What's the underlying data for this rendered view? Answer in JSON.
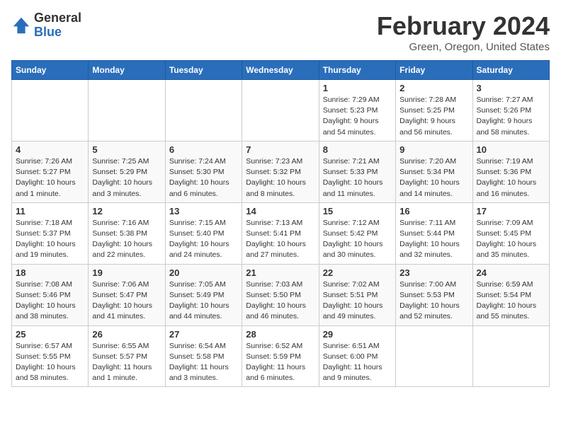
{
  "logo": {
    "general": "General",
    "blue": "Blue"
  },
  "title": "February 2024",
  "location": "Green, Oregon, United States",
  "days_header": [
    "Sunday",
    "Monday",
    "Tuesday",
    "Wednesday",
    "Thursday",
    "Friday",
    "Saturday"
  ],
  "weeks": [
    [
      {
        "day": "",
        "info": ""
      },
      {
        "day": "",
        "info": ""
      },
      {
        "day": "",
        "info": ""
      },
      {
        "day": "",
        "info": ""
      },
      {
        "day": "1",
        "info": "Sunrise: 7:29 AM\nSunset: 5:23 PM\nDaylight: 9 hours\nand 54 minutes."
      },
      {
        "day": "2",
        "info": "Sunrise: 7:28 AM\nSunset: 5:25 PM\nDaylight: 9 hours\nand 56 minutes."
      },
      {
        "day": "3",
        "info": "Sunrise: 7:27 AM\nSunset: 5:26 PM\nDaylight: 9 hours\nand 58 minutes."
      }
    ],
    [
      {
        "day": "4",
        "info": "Sunrise: 7:26 AM\nSunset: 5:27 PM\nDaylight: 10 hours\nand 1 minute."
      },
      {
        "day": "5",
        "info": "Sunrise: 7:25 AM\nSunset: 5:29 PM\nDaylight: 10 hours\nand 3 minutes."
      },
      {
        "day": "6",
        "info": "Sunrise: 7:24 AM\nSunset: 5:30 PM\nDaylight: 10 hours\nand 6 minutes."
      },
      {
        "day": "7",
        "info": "Sunrise: 7:23 AM\nSunset: 5:32 PM\nDaylight: 10 hours\nand 8 minutes."
      },
      {
        "day": "8",
        "info": "Sunrise: 7:21 AM\nSunset: 5:33 PM\nDaylight: 10 hours\nand 11 minutes."
      },
      {
        "day": "9",
        "info": "Sunrise: 7:20 AM\nSunset: 5:34 PM\nDaylight: 10 hours\nand 14 minutes."
      },
      {
        "day": "10",
        "info": "Sunrise: 7:19 AM\nSunset: 5:36 PM\nDaylight: 10 hours\nand 16 minutes."
      }
    ],
    [
      {
        "day": "11",
        "info": "Sunrise: 7:18 AM\nSunset: 5:37 PM\nDaylight: 10 hours\nand 19 minutes."
      },
      {
        "day": "12",
        "info": "Sunrise: 7:16 AM\nSunset: 5:38 PM\nDaylight: 10 hours\nand 22 minutes."
      },
      {
        "day": "13",
        "info": "Sunrise: 7:15 AM\nSunset: 5:40 PM\nDaylight: 10 hours\nand 24 minutes."
      },
      {
        "day": "14",
        "info": "Sunrise: 7:13 AM\nSunset: 5:41 PM\nDaylight: 10 hours\nand 27 minutes."
      },
      {
        "day": "15",
        "info": "Sunrise: 7:12 AM\nSunset: 5:42 PM\nDaylight: 10 hours\nand 30 minutes."
      },
      {
        "day": "16",
        "info": "Sunrise: 7:11 AM\nSunset: 5:44 PM\nDaylight: 10 hours\nand 32 minutes."
      },
      {
        "day": "17",
        "info": "Sunrise: 7:09 AM\nSunset: 5:45 PM\nDaylight: 10 hours\nand 35 minutes."
      }
    ],
    [
      {
        "day": "18",
        "info": "Sunrise: 7:08 AM\nSunset: 5:46 PM\nDaylight: 10 hours\nand 38 minutes."
      },
      {
        "day": "19",
        "info": "Sunrise: 7:06 AM\nSunset: 5:47 PM\nDaylight: 10 hours\nand 41 minutes."
      },
      {
        "day": "20",
        "info": "Sunrise: 7:05 AM\nSunset: 5:49 PM\nDaylight: 10 hours\nand 44 minutes."
      },
      {
        "day": "21",
        "info": "Sunrise: 7:03 AM\nSunset: 5:50 PM\nDaylight: 10 hours\nand 46 minutes."
      },
      {
        "day": "22",
        "info": "Sunrise: 7:02 AM\nSunset: 5:51 PM\nDaylight: 10 hours\nand 49 minutes."
      },
      {
        "day": "23",
        "info": "Sunrise: 7:00 AM\nSunset: 5:53 PM\nDaylight: 10 hours\nand 52 minutes."
      },
      {
        "day": "24",
        "info": "Sunrise: 6:59 AM\nSunset: 5:54 PM\nDaylight: 10 hours\nand 55 minutes."
      }
    ],
    [
      {
        "day": "25",
        "info": "Sunrise: 6:57 AM\nSunset: 5:55 PM\nDaylight: 10 hours\nand 58 minutes."
      },
      {
        "day": "26",
        "info": "Sunrise: 6:55 AM\nSunset: 5:57 PM\nDaylight: 11 hours\nand 1 minute."
      },
      {
        "day": "27",
        "info": "Sunrise: 6:54 AM\nSunset: 5:58 PM\nDaylight: 11 hours\nand 3 minutes."
      },
      {
        "day": "28",
        "info": "Sunrise: 6:52 AM\nSunset: 5:59 PM\nDaylight: 11 hours\nand 6 minutes."
      },
      {
        "day": "29",
        "info": "Sunrise: 6:51 AM\nSunset: 6:00 PM\nDaylight: 11 hours\nand 9 minutes."
      },
      {
        "day": "",
        "info": ""
      },
      {
        "day": "",
        "info": ""
      }
    ]
  ]
}
